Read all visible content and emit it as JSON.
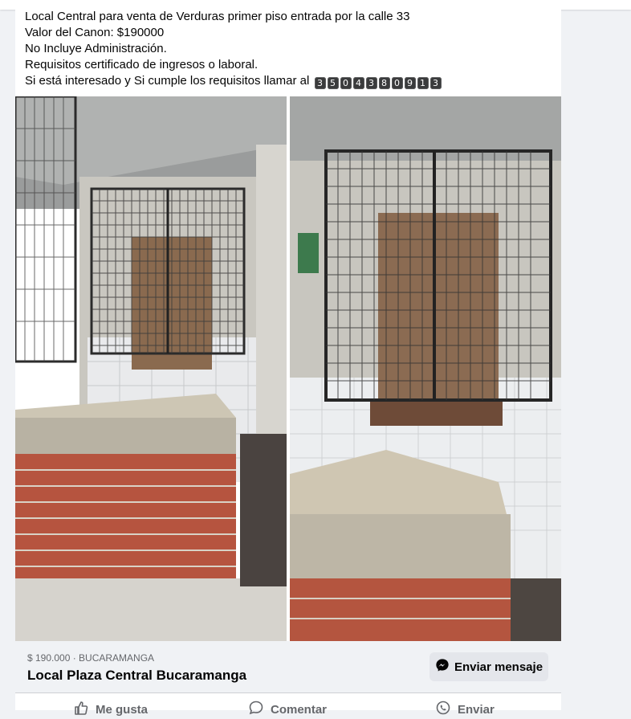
{
  "post": {
    "lines": [
      "Local Central para venta de Verduras primer piso entrada por la calle 33",
      "Valor del Canon: $190000",
      "No Incluye Administración.",
      "Requisitos certificado de ingresos o laboral.",
      "Si está interesado y Si cumple los requisitos llamar al"
    ],
    "phone_digits": [
      "3",
      "5",
      "0",
      "4",
      "3",
      "8",
      "0",
      "9",
      "1",
      "3"
    ]
  },
  "listing": {
    "price_location": "$ 190.000 · BUCARAMANGA",
    "title": "Local Plaza Central Bucaramanga",
    "message_button": "Enviar mensaje"
  },
  "actions": {
    "like": "Me gusta",
    "comment": "Comentar",
    "send": "Enviar"
  },
  "icons": {
    "message": "messenger-icon",
    "like": "thumbs-up-icon",
    "comment": "comment-icon",
    "send": "whatsapp-icon"
  }
}
